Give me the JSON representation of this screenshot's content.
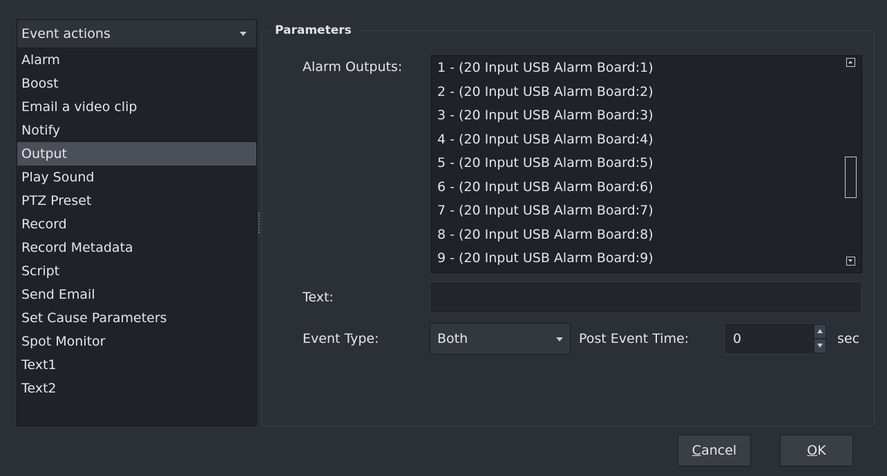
{
  "left": {
    "combo_label": "Event actions",
    "items": [
      "Alarm",
      "Boost",
      "Email a video clip",
      "Notify",
      "Output",
      "Play Sound",
      "PTZ Preset",
      "Record",
      "Record Metadata",
      "Script",
      "Send Email",
      "Set Cause Parameters",
      "Spot Monitor",
      "Text1",
      "Text2"
    ],
    "selected_item": "Output"
  },
  "params": {
    "title": "Parameters",
    "alarm_outputs_label": "Alarm Outputs:",
    "alarm_outputs": [
      "1 - (20 Input USB Alarm Board:1)",
      "2 - (20 Input USB Alarm Board:2)",
      "3 - (20 Input USB Alarm Board:3)",
      "4 - (20 Input USB Alarm Board:4)",
      "5 - (20 Input USB Alarm Board:5)",
      "6 - (20 Input USB Alarm Board:6)",
      "7 - (20 Input USB Alarm Board:7)",
      "8 - (20 Input USB Alarm Board:8)",
      "9 - (20 Input USB Alarm Board:9)"
    ],
    "text_label": "Text:",
    "text_value": "",
    "event_type_label": "Event Type:",
    "event_type_value": "Both",
    "post_event_time_label": "Post Event Time:",
    "post_event_time_value": "0",
    "post_event_time_unit": "sec"
  },
  "buttons": {
    "cancel_mnemonic": "C",
    "cancel_rest": "ancel",
    "ok_mnemonic": "O",
    "ok_rest": "K"
  },
  "colors": {
    "window_bg": "#2b2f36",
    "list_bg": "#1f2227",
    "selection_bg": "#4b5058",
    "text": "#e4e6ea"
  }
}
